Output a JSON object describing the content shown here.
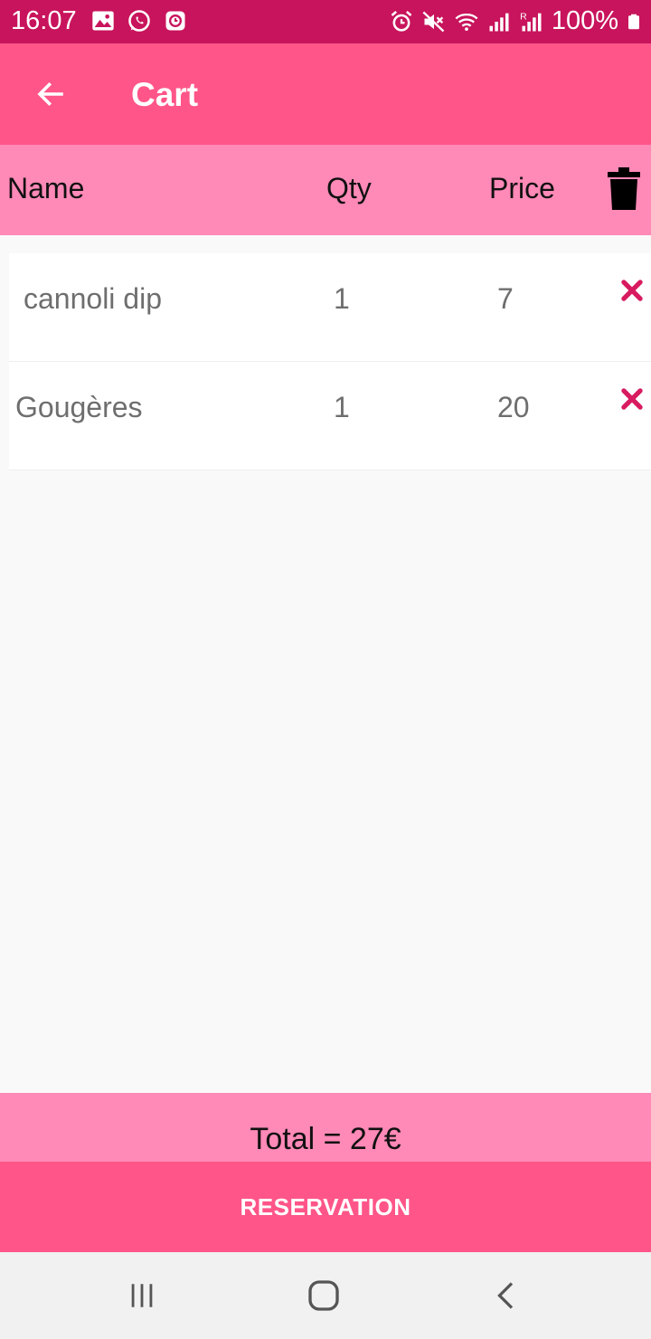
{
  "status_bar": {
    "time": "16:07",
    "battery": "100%",
    "left_icons": [
      "image-icon",
      "whatsapp-icon",
      "clock-app-icon"
    ],
    "right_icons": [
      "alarm-icon",
      "mute-icon",
      "wifi-icon",
      "signal-icon",
      "signal-roaming-icon",
      "battery-icon"
    ]
  },
  "app_bar": {
    "title": "Cart",
    "back_icon": "arrow-left-icon",
    "background": "#ff5588"
  },
  "table_header": {
    "name": "Name",
    "qty": "Qty",
    "price": "Price",
    "delete_all_icon": "trash-icon",
    "background": "#ff89b7"
  },
  "cart": {
    "items": [
      {
        "name": "cannoli dip",
        "qty": "1",
        "price": "7"
      },
      {
        "name": "Gougères",
        "qty": "1",
        "price": "20"
      }
    ],
    "remove_icon": "close-icon",
    "remove_color": "#d81b60"
  },
  "total": {
    "text": "Total = 27€"
  },
  "actions": {
    "reservation_label": "RESERVATION"
  },
  "nav_bar": {
    "buttons": [
      "recent-apps-icon",
      "home-icon",
      "back-icon"
    ]
  }
}
